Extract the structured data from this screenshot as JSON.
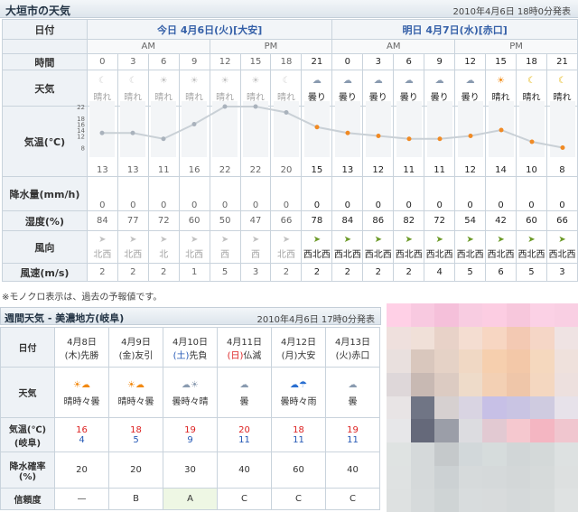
{
  "title": "大垣市の天気",
  "published": "2010年4月6日 18時0分発表",
  "labels": {
    "date": "日付",
    "time": "時間",
    "weather": "天気",
    "temp": "気温(℃)",
    "precip": "降水量(mm/h)",
    "humidity": "湿度(%)",
    "wind_dir": "風向",
    "wind_speed": "風速(m/s)"
  },
  "days": [
    {
      "label": "今日 4月6日(火)[大安]",
      "am": "AM",
      "pm": "PM"
    },
    {
      "label": "明日 4月7日(水)[赤口]",
      "am": "AM",
      "pm": "PM"
    }
  ],
  "hours": [
    "0",
    "3",
    "6",
    "9",
    "12",
    "15",
    "18",
    "21",
    "0",
    "3",
    "6",
    "9",
    "12",
    "15",
    "18",
    "21"
  ],
  "weather": [
    {
      "icon": "moon-icon",
      "glyph": "☾",
      "text": "晴れ",
      "past": true
    },
    {
      "icon": "moon-icon",
      "glyph": "☾",
      "text": "晴れ",
      "past": true
    },
    {
      "icon": "sun-icon",
      "glyph": "☀",
      "text": "晴れ",
      "past": true
    },
    {
      "icon": "sun-icon",
      "glyph": "☀",
      "text": "晴れ",
      "past": true
    },
    {
      "icon": "sun-icon",
      "glyph": "☀",
      "text": "晴れ",
      "past": true
    },
    {
      "icon": "sun-icon",
      "glyph": "☀",
      "text": "晴れ",
      "past": true
    },
    {
      "icon": "moon-icon",
      "glyph": "☾",
      "text": "晴れ",
      "past": true
    },
    {
      "icon": "cloud-icon",
      "glyph": "☁",
      "text": "曇り",
      "past": false
    },
    {
      "icon": "cloud-icon",
      "glyph": "☁",
      "text": "曇り",
      "past": false
    },
    {
      "icon": "cloud-icon",
      "glyph": "☁",
      "text": "曇り",
      "past": false
    },
    {
      "icon": "cloud-icon",
      "glyph": "☁",
      "text": "曇り",
      "past": false
    },
    {
      "icon": "cloud-icon",
      "glyph": "☁",
      "text": "曇り",
      "past": false
    },
    {
      "icon": "cloud-icon",
      "glyph": "☁",
      "text": "曇り",
      "past": false
    },
    {
      "icon": "sun-icon",
      "glyph": "☀",
      "text": "晴れ",
      "past": false
    },
    {
      "icon": "moon-icon",
      "glyph": "☾",
      "text": "晴れ",
      "past": false
    },
    {
      "icon": "moon-icon",
      "glyph": "☾",
      "text": "晴れ",
      "past": false
    }
  ],
  "temps": [
    13,
    13,
    11,
    16,
    22,
    22,
    20,
    15,
    13,
    12,
    11,
    11,
    12,
    14,
    10,
    8
  ],
  "temp_axis": [
    "22",
    "18",
    "16",
    "14",
    "12",
    "8"
  ],
  "precip": [
    "0",
    "0",
    "0",
    "0",
    "0",
    "0",
    "0",
    "0",
    "0",
    "0",
    "0",
    "0",
    "0",
    "0",
    "0",
    "0"
  ],
  "humidity": [
    "84",
    "77",
    "72",
    "60",
    "50",
    "47",
    "66",
    "78",
    "84",
    "86",
    "82",
    "72",
    "54",
    "42",
    "60",
    "66"
  ],
  "wind_dir": [
    "北西",
    "北西",
    "北",
    "北西",
    "西",
    "西",
    "北西",
    "西北西",
    "西北西",
    "西北西",
    "西北西",
    "西北西",
    "西北西",
    "西北西",
    "西北西",
    "西北西"
  ],
  "wind_speed": [
    "2",
    "2",
    "2",
    "1",
    "5",
    "3",
    "2",
    "2",
    "2",
    "2",
    "2",
    "4",
    "5",
    "6",
    "5",
    "3"
  ],
  "note": "※モノクロ表示は、過去の予報値です。",
  "weekly": {
    "title": "週間天気 - 美濃地方(岐阜)",
    "published": "2010年4月6日 17時0分発表",
    "labels": {
      "date": "日付",
      "weather": "天気",
      "temp": "気温(℃)",
      "temp_loc": "(岐阜)",
      "pop": "降水確率",
      "pop_unit": "(%)",
      "reliability": "信頼度"
    },
    "days": [
      {
        "date": "4月8日",
        "dow": "(木)",
        "rokuyo": "先勝",
        "dow_type": "weekday",
        "icon": "sun-cloud-icon",
        "glyph": "☀☁",
        "text": "晴時々曇",
        "high": "16",
        "low": "4",
        "pop": "20",
        "rel": "—"
      },
      {
        "date": "4月9日",
        "dow": "(金)",
        "rokuyo": "友引",
        "dow_type": "weekday",
        "icon": "sun-cloud-icon",
        "glyph": "☀☁",
        "text": "晴時々曇",
        "high": "18",
        "low": "5",
        "pop": "20",
        "rel": "B"
      },
      {
        "date": "4月10日",
        "dow": "(土)",
        "rokuyo": "先負",
        "dow_type": "sat",
        "icon": "cloud-sun-icon",
        "glyph": "☁☀",
        "text": "曇時々晴",
        "high": "19",
        "low": "9",
        "pop": "30",
        "rel": "A"
      },
      {
        "date": "4月11日",
        "dow": "(日)",
        "rokuyo": "仏滅",
        "dow_type": "sun",
        "icon": "cloud-icon",
        "glyph": "☁",
        "text": "曇",
        "high": "20",
        "low": "11",
        "pop": "40",
        "rel": "C"
      },
      {
        "date": "4月12日",
        "dow": "(月)",
        "rokuyo": "大安",
        "dow_type": "weekday",
        "icon": "cloud-umbrella-icon",
        "glyph": "☁☂",
        "text": "曇時々雨",
        "high": "18",
        "low": "11",
        "pop": "60",
        "rel": "C"
      },
      {
        "date": "4月13日",
        "dow": "(火)",
        "rokuyo": "赤口",
        "dow_type": "weekday",
        "icon": "cloud-icon",
        "glyph": "☁",
        "text": "曇",
        "high": "19",
        "low": "11",
        "pop": "40",
        "rel": "C"
      }
    ]
  },
  "colors": {
    "accent": "#3560a8",
    "high": "#d22222",
    "low": "#2357b5",
    "temp_line": "#c9d0d6",
    "temp_marker_future": "#f08a24",
    "temp_marker_past": "#a9b2bc"
  },
  "mosaic": [
    "#ffd0e6",
    "#f8c9e0",
    "#f5c0da",
    "#f8cce1",
    "#fccde2",
    "#f7c7dc",
    "#fbd1e5",
    "#f9cfe3",
    "#efe0dd",
    "#f0e0d8",
    "#e8d2c8",
    "#f4ddd1",
    "#f7d6c2",
    "#f3c9b3",
    "#f5d6c6",
    "#efe3e3",
    "#e9e0de",
    "#d9c7bd",
    "#e5d2c6",
    "#f0d8c4",
    "#f6cfae",
    "#f3c8a8",
    "#f5d8be",
    "#efe1dc",
    "#ded7d9",
    "#c8b9b3",
    "#dccbc2",
    "#eedbc9",
    "#f3d0b4",
    "#efc6a9",
    "#f4d7c0",
    "#ede0de",
    "#e8e4e5",
    "#707585",
    "#d6d0d0",
    "#d9d4e2",
    "#c7c0e6",
    "#c9c4e3",
    "#cfcbe0",
    "#e7e2ea",
    "#e7e7e9",
    "#65697a",
    "#9b9ea8",
    "#dcdce0",
    "#e2c9d2",
    "#f5c8cf",
    "#f4b6c2",
    "#f0c6cf",
    "#dfe3e2",
    "#d5d9da",
    "#c5c9cb",
    "#d2d8da",
    "#d6dcdc",
    "#d1d6d7",
    "#d4d9d9",
    "#dde1e1",
    "#dfe2e2",
    "#d5d9da",
    "#ccd1d3",
    "#d6dadb",
    "#d5d9da",
    "#d3d7d8",
    "#d6dada",
    "#dde0e0",
    "#dee1e1",
    "#d6dadb",
    "#cfd4d5",
    "#d8dcdd",
    "#d8dbdc",
    "#d5d9da",
    "#d7dbdb",
    "#dfe2e2"
  ]
}
